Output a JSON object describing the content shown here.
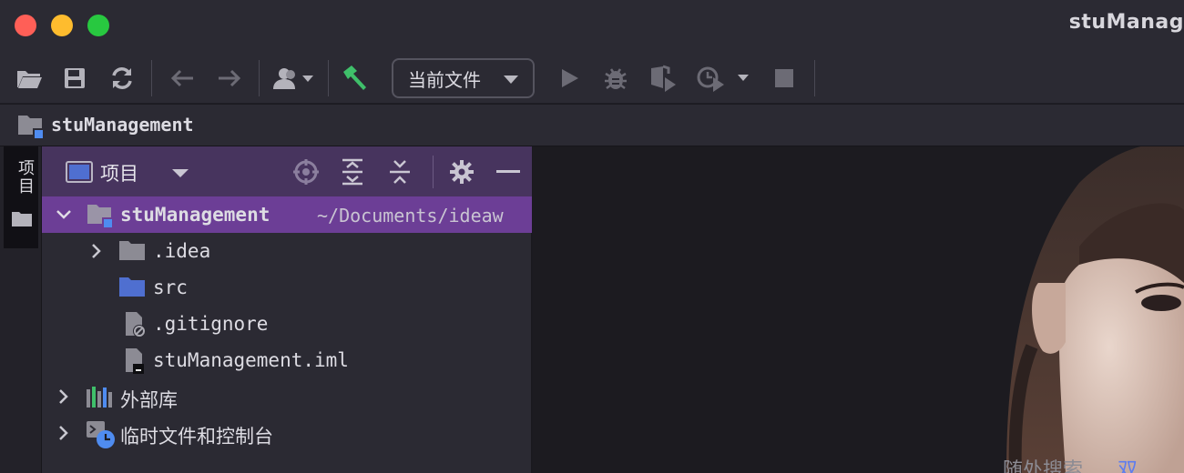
{
  "window": {
    "title": "stuManag"
  },
  "toolbar": {
    "buttons": [
      {
        "name": "open-folder-icon"
      },
      {
        "name": "save-icon"
      },
      {
        "name": "sync-icon"
      },
      {
        "name": "back-arrow-icon"
      },
      {
        "name": "forward-arrow-icon"
      },
      {
        "name": "user-icon"
      },
      {
        "name": "build-hammer-icon"
      },
      {
        "name": "run-icon"
      },
      {
        "name": "debug-icon"
      },
      {
        "name": "coverage-icon"
      },
      {
        "name": "profile-icon"
      },
      {
        "name": "stop-icon"
      }
    ],
    "run_config_label": "当前文件"
  },
  "navbar": {
    "project_name": "stuManagement"
  },
  "side_stripe": {
    "project_tab_label": "项目"
  },
  "project_panel": {
    "title": "项目",
    "tree": [
      {
        "label": "stuManagement",
        "path": "~/Documents/ideaw",
        "expanded": true,
        "selected": true,
        "icon": "module-folder-icon"
      },
      {
        "label": ".idea",
        "expanded": false,
        "icon": "folder-icon"
      },
      {
        "label": "src",
        "icon": "source-folder-icon"
      },
      {
        "label": ".gitignore",
        "icon": "ignored-file-icon"
      },
      {
        "label": "stuManagement.iml",
        "icon": "iml-file-icon"
      },
      {
        "label": "外部库",
        "expanded": false,
        "icon": "library-icon"
      },
      {
        "label": "临时文件和控制台",
        "expanded": false,
        "icon": "scratches-icon"
      }
    ]
  },
  "editor": {
    "hint_text": "随处搜索",
    "hint_shortcut": "双"
  },
  "colors": {
    "accent_selection": "#6c3e96",
    "panel_header": "#47345e",
    "toolbar_bg": "#2b2a33",
    "build_green": "#3fbf6a",
    "source_blue": "#4f6fd0"
  }
}
